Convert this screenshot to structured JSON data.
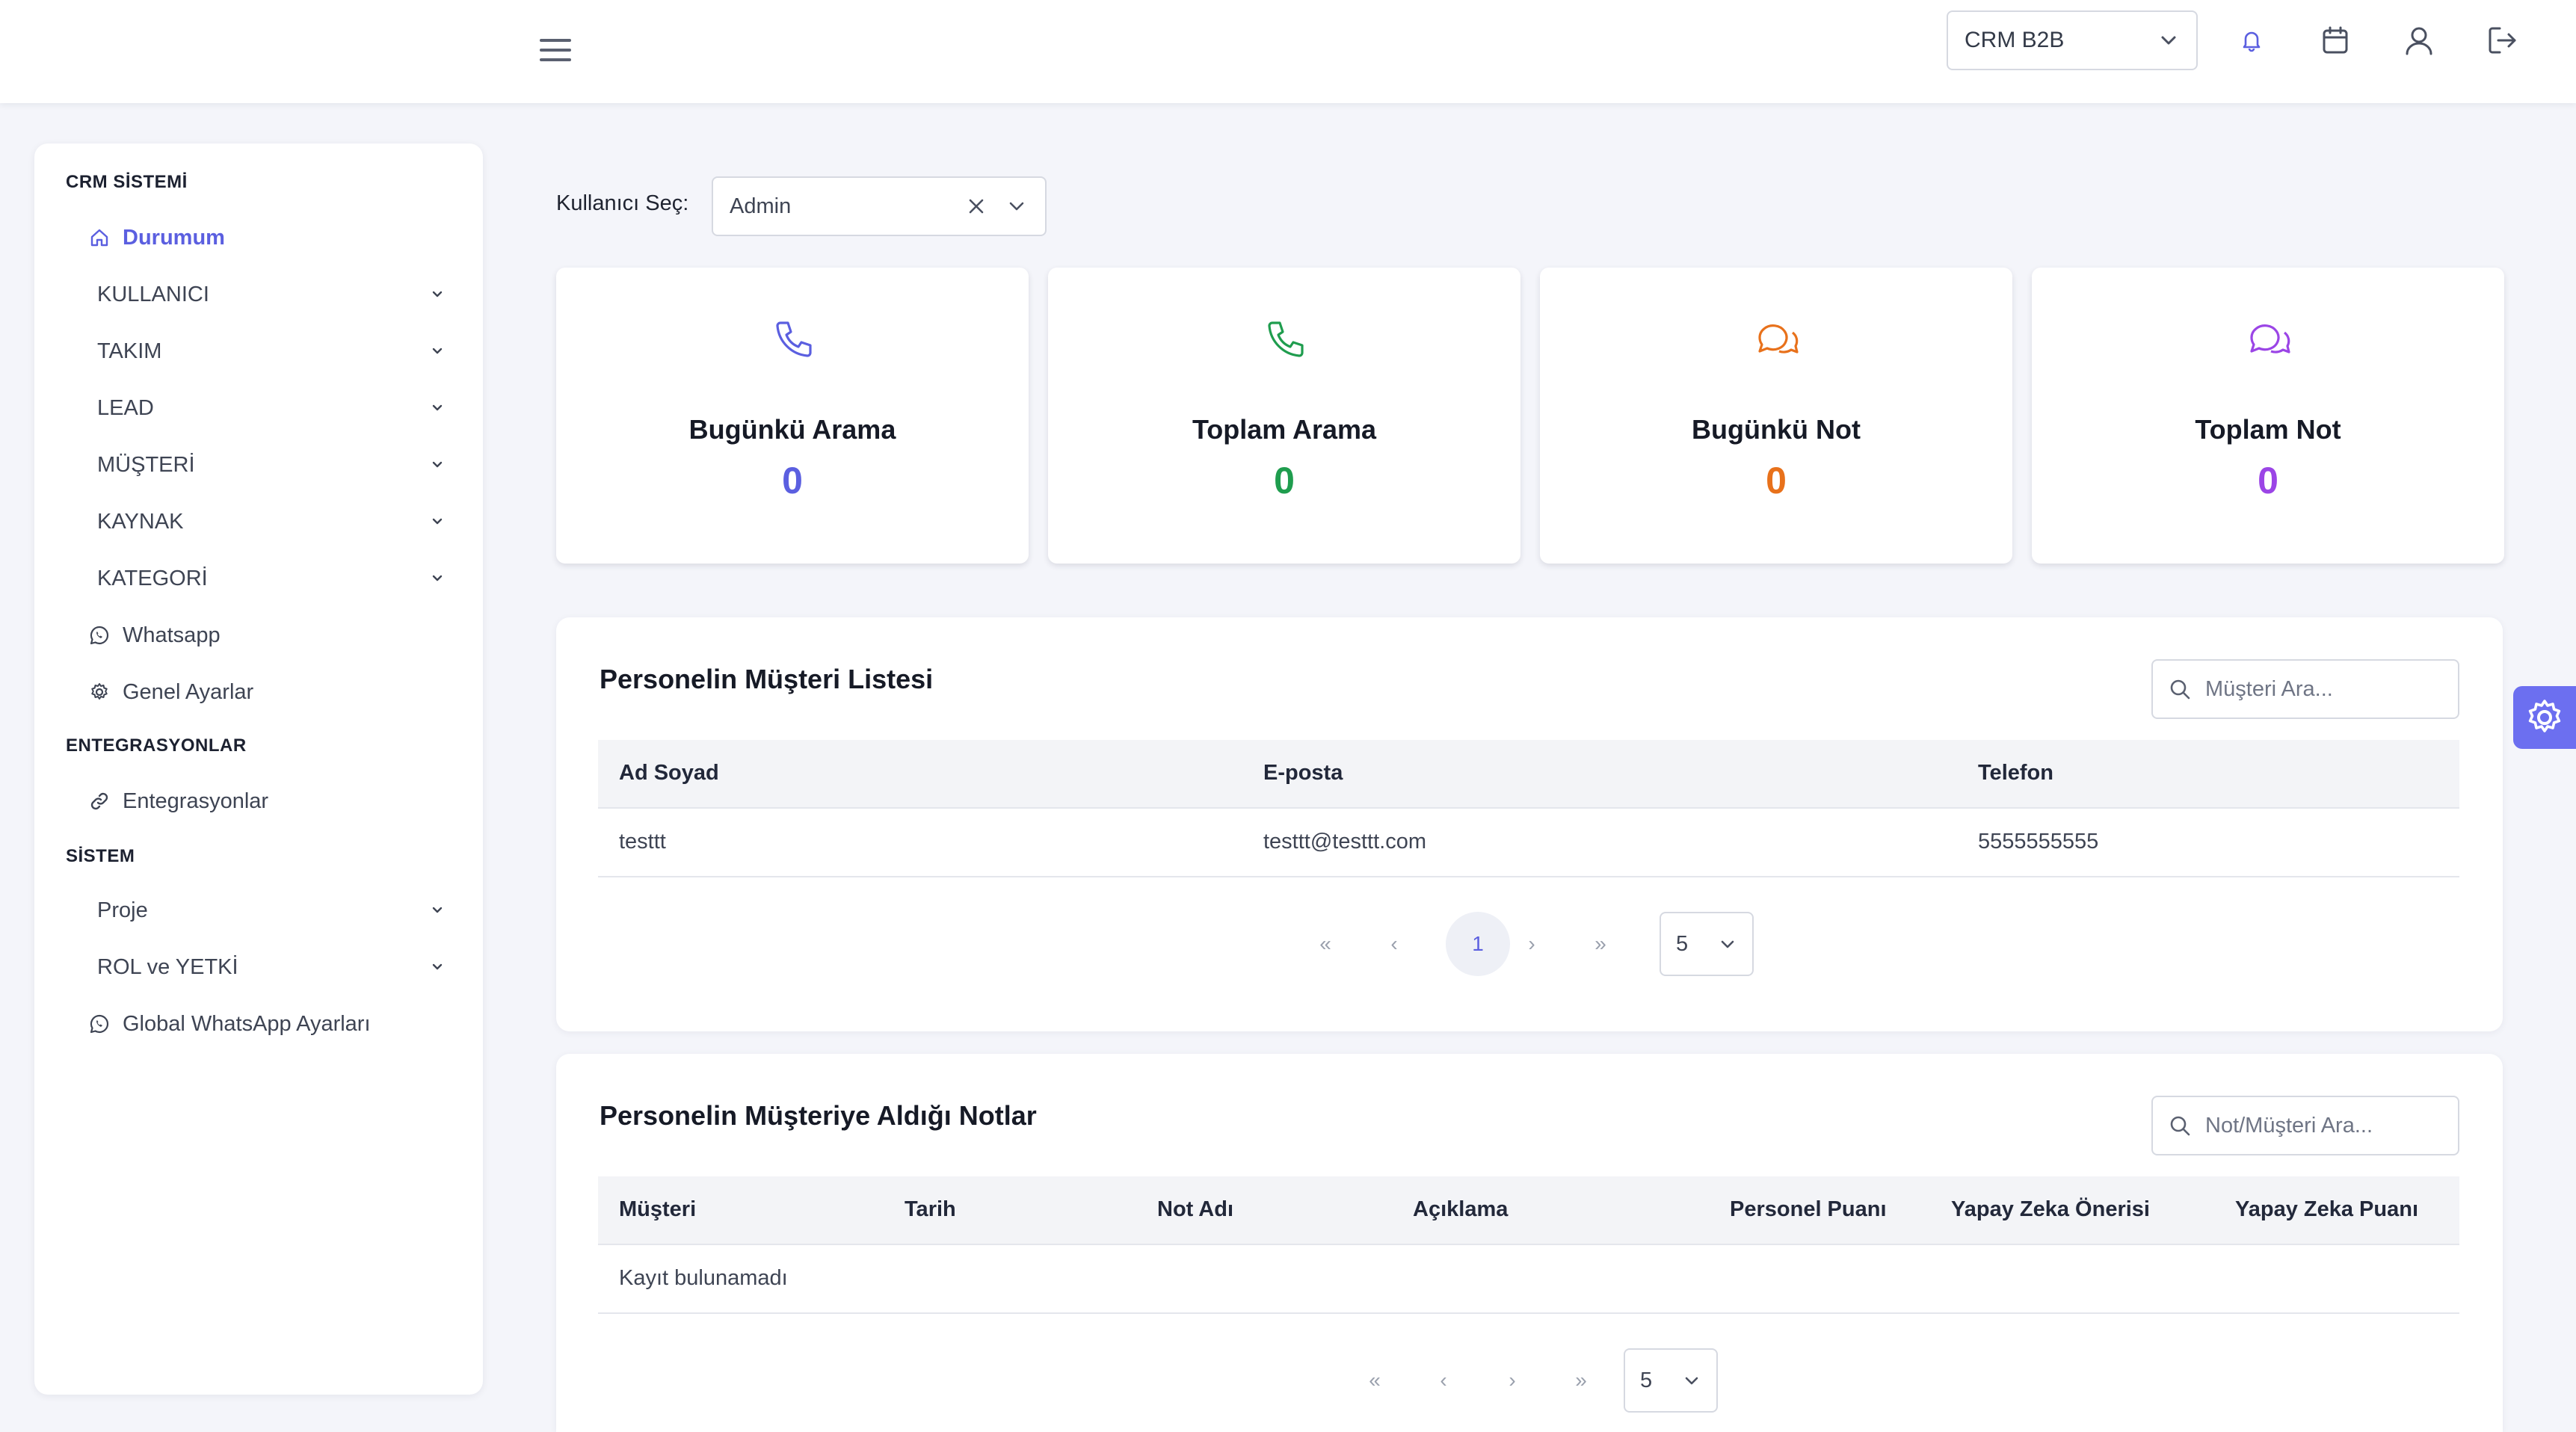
{
  "colors": {
    "accent": "#5b5fe0",
    "blue": "#5b5fe0",
    "green": "#1f9d4e",
    "orange": "#e8711b",
    "purple": "#9b45e6"
  },
  "topbar": {
    "menu_icon": "hamburger-icon",
    "company_select": {
      "value": "CRM B2B"
    },
    "icons": [
      "bell-icon",
      "calendar-icon",
      "user-icon",
      "logout-icon"
    ]
  },
  "sidebar": {
    "section_crm": "CRM SİSTEMİ",
    "items_crm": [
      {
        "label": "Durumum",
        "icon": "home-icon",
        "active": true
      },
      {
        "label": "KULLANICI"
      },
      {
        "label": "TAKIM"
      },
      {
        "label": "LEAD"
      },
      {
        "label": "MÜŞTERİ"
      },
      {
        "label": "KAYNAK"
      },
      {
        "label": "KATEGORİ"
      },
      {
        "label": "Whatsapp",
        "icon": "whatsapp-icon"
      },
      {
        "label": "Genel Ayarlar",
        "icon": "gear-icon"
      }
    ],
    "section_integrations": "ENTEGRASYONLAR",
    "items_integrations": [
      {
        "label": "Entegrasyonlar",
        "icon": "link-icon"
      }
    ],
    "section_system": "SİSTEM",
    "items_system": [
      {
        "label": "Proje"
      },
      {
        "label": "ROL ve YETKİ"
      },
      {
        "label": "Global WhatsApp Ayarları",
        "icon": "whatsapp-icon"
      }
    ]
  },
  "filter": {
    "label": "Kullanıcı Seç:",
    "value": "Admin"
  },
  "stats": [
    {
      "title": "Bugünkü Arama",
      "value": "0",
      "icon": "phone-icon",
      "color": "#5b5fe0"
    },
    {
      "title": "Toplam Arama",
      "value": "0",
      "icon": "phone-icon",
      "color": "#1f9d4e"
    },
    {
      "title": "Bugünkü Not",
      "value": "0",
      "icon": "chat-icon",
      "color": "#e8711b"
    },
    {
      "title": "Toplam Not",
      "value": "0",
      "icon": "chat-icon",
      "color": "#9b45e6"
    }
  ],
  "customers": {
    "title": "Personelin Müşteri Listesi",
    "search_placeholder": "Müşteri Ara...",
    "columns": [
      "Ad Soyad",
      "E-posta",
      "Telefon"
    ],
    "rows": [
      [
        "testtt",
        "testtt@testtt.com",
        "5555555555"
      ]
    ],
    "pager": {
      "current_page": "1",
      "page_size": "5"
    }
  },
  "notes": {
    "title": "Personelin Müşteriye Aldığı Notlar",
    "search_placeholder": "Not/Müşteri Ara...",
    "columns": [
      "Müşteri",
      "Tarih",
      "Not Adı",
      "Açıklama",
      "Personel Puanı",
      "Yapay Zeka Önerisi",
      "Yapay Zeka Puanı"
    ],
    "empty_text": "Kayıt bulunamadı",
    "pager": {
      "page_size": "5"
    }
  }
}
